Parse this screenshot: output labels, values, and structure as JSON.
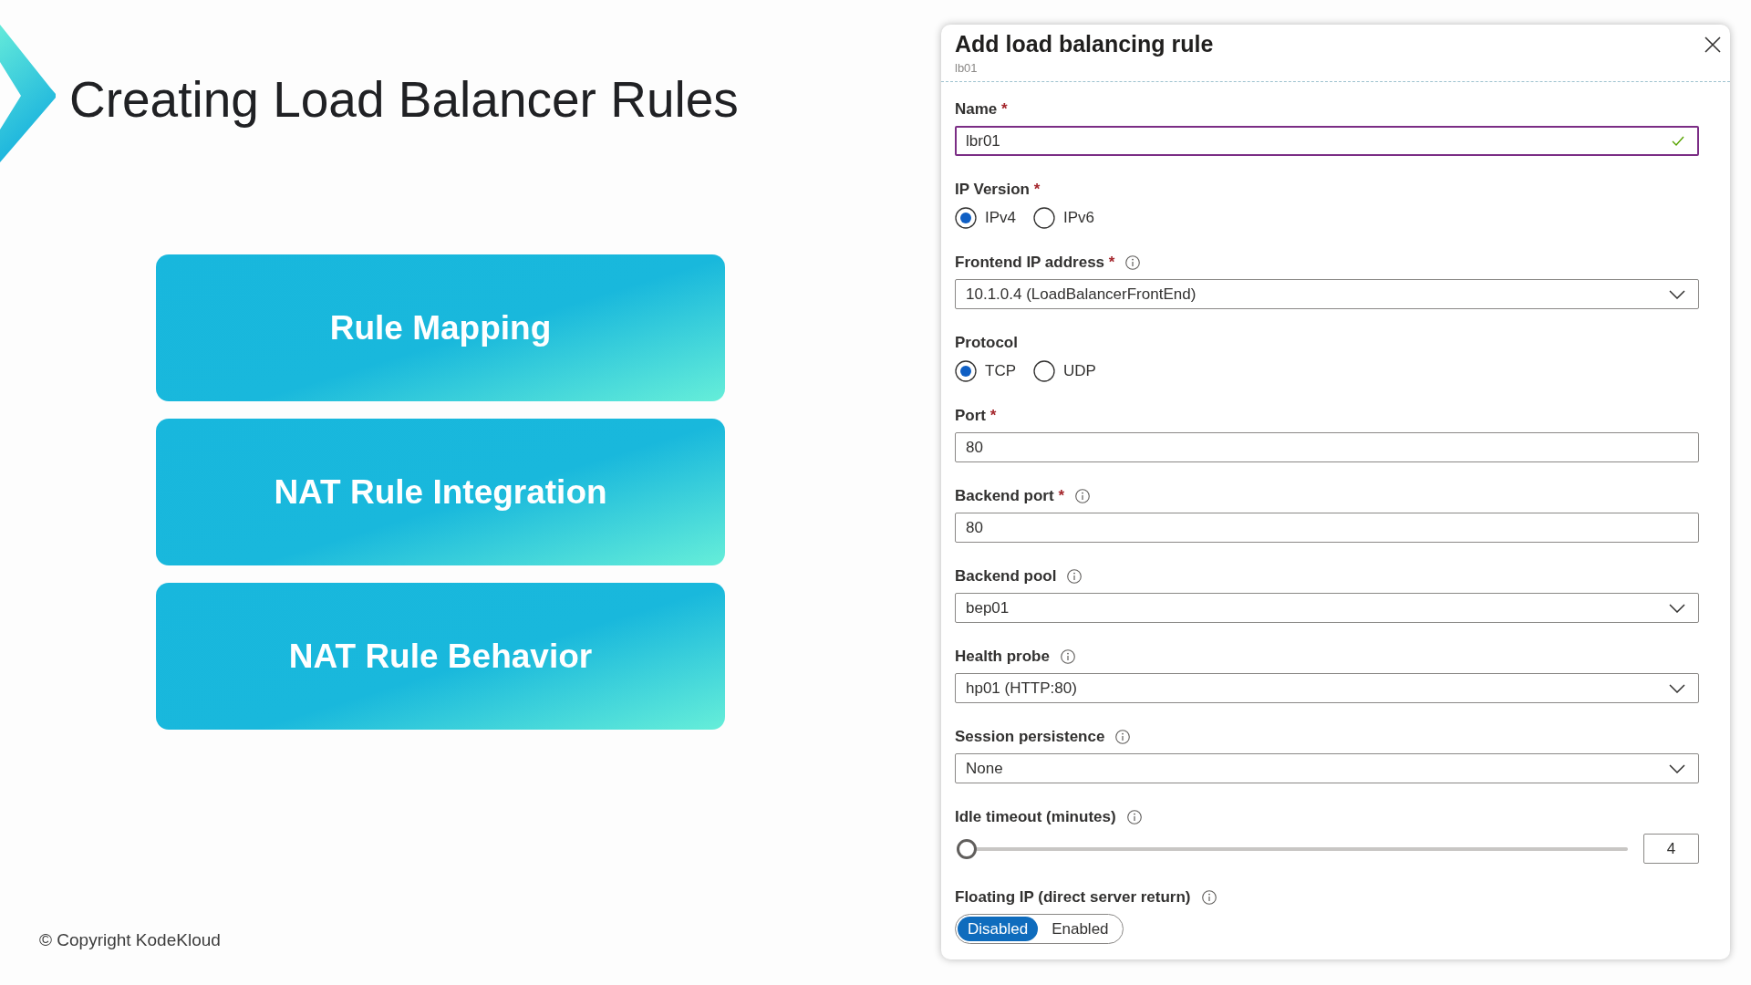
{
  "slide": {
    "title": "Creating Load Balancer Rules",
    "cards": [
      {
        "label": "Rule Mapping"
      },
      {
        "label": "NAT Rule Integration"
      },
      {
        "label": "NAT Rule Behavior"
      }
    ],
    "copyright": "© Copyright KodeKloud"
  },
  "panel": {
    "title": "Add load balancing rule",
    "subtitle": "lb01",
    "fields": [
      {
        "kind": "text",
        "label": "Name",
        "required_mark": "*",
        "info": false,
        "value": "lbr01",
        "focused": true,
        "valid": true
      },
      {
        "kind": "radio",
        "label": "IP Version",
        "required_mark": "*",
        "info": false,
        "options": [
          {
            "label": "IPv4",
            "selected": true
          },
          {
            "label": "IPv6",
            "selected": false
          }
        ]
      },
      {
        "kind": "dropdown",
        "label": "Frontend IP address",
        "required_mark": "*",
        "info": true,
        "value": "10.1.0.4 (LoadBalancerFrontEnd)"
      },
      {
        "kind": "radio",
        "label": "Protocol",
        "info": false,
        "options": [
          {
            "label": "TCP",
            "selected": true
          },
          {
            "label": "UDP",
            "selected": false
          }
        ]
      },
      {
        "kind": "text",
        "label": "Port",
        "required_mark": "*",
        "info": false,
        "value": "80",
        "focused": false,
        "valid": false
      },
      {
        "kind": "text",
        "label": "Backend port",
        "required_mark": "*",
        "info": true,
        "value": "80",
        "focused": false,
        "valid": false
      },
      {
        "kind": "dropdown",
        "label": "Backend pool",
        "info": true,
        "value": "bep01"
      },
      {
        "kind": "dropdown",
        "label": "Health probe",
        "info": true,
        "value": "hp01 (HTTP:80)"
      },
      {
        "kind": "dropdown",
        "label": "Session persistence",
        "info": true,
        "value": "None"
      },
      {
        "kind": "slider",
        "label": "Idle timeout (minutes)",
        "info": true,
        "level": 0,
        "value": "4"
      },
      {
        "kind": "toggle",
        "label": "Floating IP (direct server return)",
        "info": true,
        "options": [
          {
            "label": "Disabled",
            "selected": true
          },
          {
            "label": "Enabled",
            "selected": false
          }
        ]
      }
    ]
  }
}
